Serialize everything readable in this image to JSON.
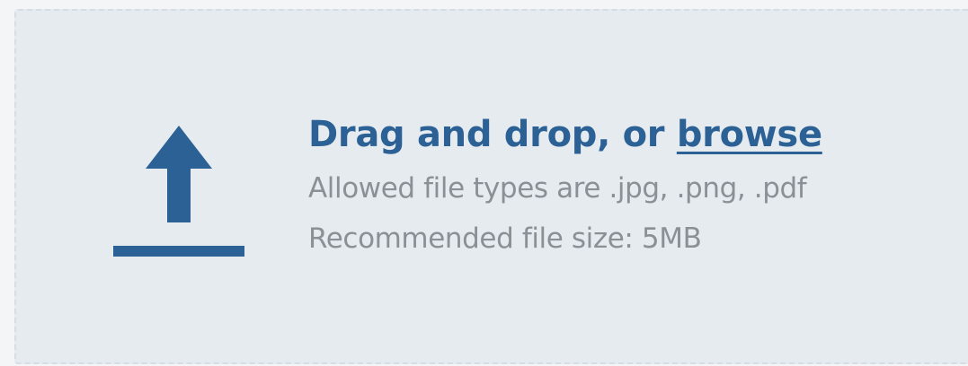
{
  "dropzone": {
    "headline_prefix": "Drag and drop, or ",
    "browse_label": "browse",
    "allowed_types_text": "Allowed file types are .jpg, .png, .pdf",
    "recommended_size_text": "Recommended file size: 5MB",
    "icon": "upload-icon"
  },
  "colors": {
    "accent": "#2c6195",
    "muted_text": "#8b9097",
    "zone_background": "#e6ebf0",
    "zone_border": "#d6dde4"
  }
}
